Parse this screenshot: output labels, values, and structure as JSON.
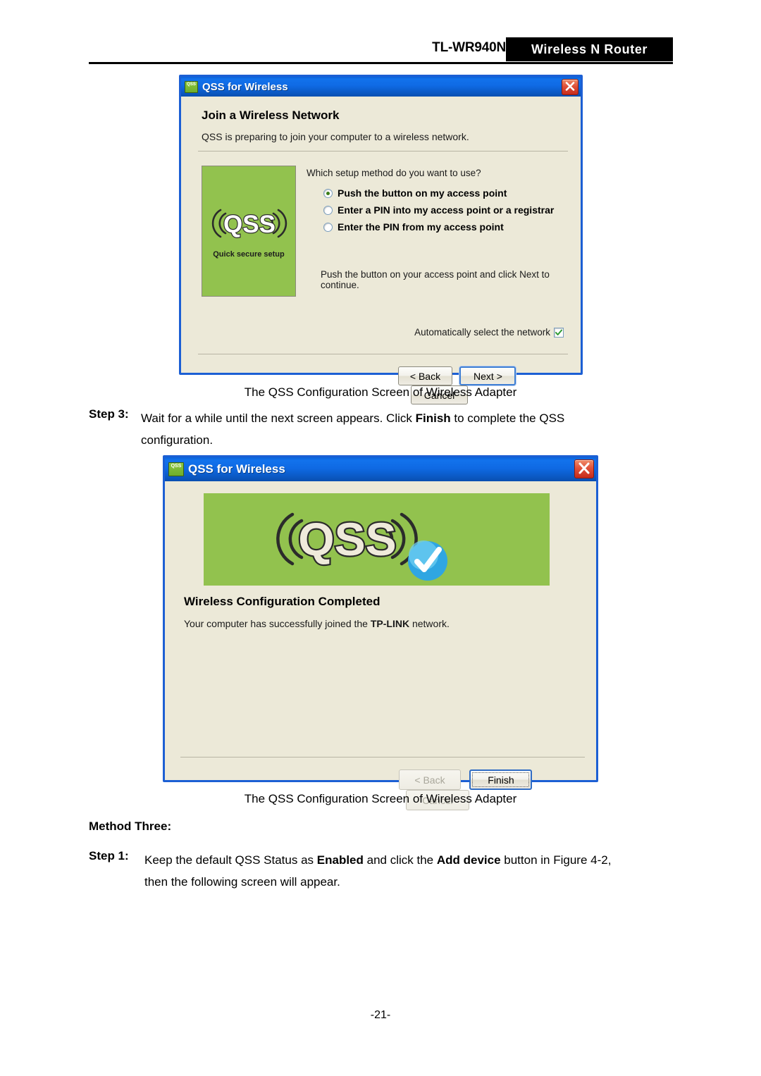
{
  "header": {
    "model": "TL-WR940N",
    "product": "Wireless N Router"
  },
  "dialog1": {
    "title": "QSS for Wireless",
    "heading": "Join a Wireless Network",
    "subtitle": "QSS is preparing to join your computer to a wireless network.",
    "logo": {
      "brand": "QSS",
      "caption": "Quick secure setup"
    },
    "question": "Which setup method do you want to use?",
    "options": [
      {
        "label": "Push the button on my access point",
        "selected": true
      },
      {
        "label": "Enter a PIN into my access point or a registrar",
        "selected": false
      },
      {
        "label": "Enter the PIN from my access point",
        "selected": false
      }
    ],
    "hint": "Push the button on your access point and click Next to continue.",
    "checkbox": {
      "label": "Automatically select the network",
      "checked": true
    },
    "buttons": {
      "back": "< Back",
      "next": "Next >",
      "cancel": "Cancel"
    }
  },
  "caption1": "The QSS Configuration Screen of Wireless Adapter",
  "step3": {
    "label": "Step 3:",
    "line1_a": "Wait for a while until the next screen appears. Click ",
    "line1_b": "Finish",
    "line1_c": " to complete the QSS",
    "line2": "configuration."
  },
  "dialog2": {
    "title": "QSS for Wireless",
    "logo": {
      "brand": "QSS"
    },
    "heading": "Wireless Configuration Completed",
    "message_a": "Your computer has successfully joined the ",
    "message_b": "TP-LINK",
    "message_c": " network.",
    "buttons": {
      "back": "< Back",
      "finish": "Finish",
      "cancel": "Cancel"
    }
  },
  "caption2": "The QSS Configuration Screen of Wireless Adapter",
  "method_three": "Method Three:",
  "step1": {
    "label": "Step 1:",
    "line1_a": "Keep the default QSS Status as ",
    "line1_b": "Enabled",
    "line1_c": " and click the ",
    "line1_d": "Add device",
    "line1_e": " button in Figure 4-2,",
    "line2": "then the following screen will appear."
  },
  "page_number": "-21-",
  "colors": {
    "accent_blue": "#1c5fd4",
    "qss_green": "#92c24e",
    "dialog_bg": "#ece9d8",
    "check_green": "#2e9b33",
    "badge_blue": "#29a8e0"
  }
}
